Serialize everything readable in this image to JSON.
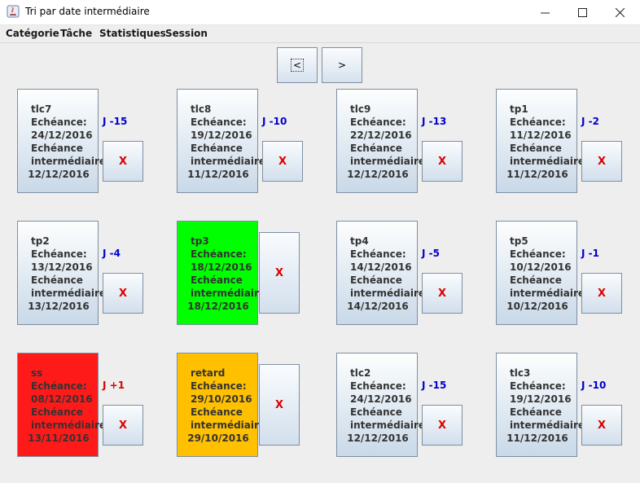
{
  "window": {
    "title": "Tri par date intermédiaire",
    "controls": {
      "minimize": "—",
      "maximize": "☐",
      "close": "✕"
    }
  },
  "menu": [
    "Catégorie",
    "Tâche",
    "Statistiques",
    "Session"
  ],
  "nav": {
    "prev_label": "<",
    "next_label": ">"
  },
  "labels": {
    "due": "Echéance:",
    "intermediate": "Echéance",
    "intermediate2": "intermédiaire:"
  },
  "delete_label": "X",
  "colors": {
    "green": "#00ff00",
    "red": "#ff1a1a",
    "orange": "#ffc000",
    "days_normal": "#0000cc",
    "days_late": "#dd0000"
  },
  "cards": [
    {
      "name": "tlc7",
      "due": "24/12/2016",
      "intermediate_due": "12/12/2016",
      "days": "J -15",
      "status": "normal"
    },
    {
      "name": "tlc8",
      "due": "19/12/2016",
      "intermediate_due": "11/12/2016",
      "days": "J -10",
      "status": "normal"
    },
    {
      "name": "tlc9",
      "due": "22/12/2016",
      "intermediate_due": "12/12/2016",
      "days": "J -13",
      "status": "normal"
    },
    {
      "name": "tp1",
      "due": "11/12/2016",
      "intermediate_due": "11/12/2016",
      "days": "J -2",
      "status": "normal"
    },
    {
      "name": "tp2",
      "due": "13/12/2016",
      "intermediate_due": "13/12/2016",
      "days": "J -4",
      "status": "normal"
    },
    {
      "name": "tp3",
      "due": "18/12/2016",
      "intermediate_due": "18/12/2016",
      "days": "",
      "status": "green"
    },
    {
      "name": "tp4",
      "due": "14/12/2016",
      "intermediate_due": "14/12/2016",
      "days": "J -5",
      "status": "normal"
    },
    {
      "name": "tp5",
      "due": "10/12/2016",
      "intermediate_due": "10/12/2016",
      "days": "J -1",
      "status": "normal"
    },
    {
      "name": "ss",
      "due": "08/12/2016",
      "intermediate_due": "13/11/2016",
      "days": "J +1",
      "status": "red"
    },
    {
      "name": "retard",
      "due": "29/10/2016",
      "intermediate_due": "29/10/2016",
      "days": "",
      "status": "orange"
    },
    {
      "name": "tlc2",
      "due": "24/12/2016",
      "intermediate_due": "12/12/2016",
      "days": "J -15",
      "status": "normal"
    },
    {
      "name": "tlc3",
      "due": "19/12/2016",
      "intermediate_due": "11/12/2016",
      "days": "J -10",
      "status": "normal"
    }
  ]
}
